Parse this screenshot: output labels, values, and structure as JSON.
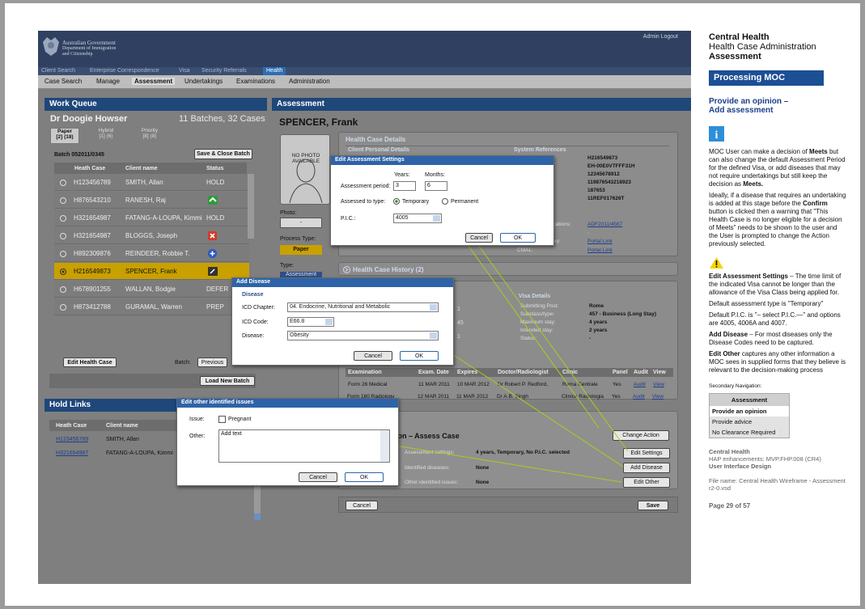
{
  "app": {
    "agency_line1": "Australian Government",
    "agency_line2": "Department of Immigration",
    "agency_line3": "and Citizenship",
    "top_links": "Admin  Logout"
  },
  "nav1": [
    "Client Search",
    "Enterprise Correspondence",
    "Visa",
    "Security Referrals",
    "Health"
  ],
  "nav2": [
    "Case Search",
    "Manage",
    "Assessment",
    "Undertakings",
    "Examinations",
    "Administration"
  ],
  "work_queue": {
    "title": "Work Queue",
    "user": "Dr Doogie Howser",
    "summary": "11 Batches, 32 Cases",
    "tabs": [
      {
        "l1": "Paper",
        "l2": "[2] (18)"
      },
      {
        "l1": "Hybrid",
        "l2": "[1] (6)"
      },
      {
        "l1": "Priority",
        "l2": "[8] (8)"
      }
    ],
    "batch": "Batch 052011/0345",
    "save_close": "Save & Close Batch",
    "columns": [
      "Heath Case",
      "Client name",
      "Status"
    ],
    "rows": [
      {
        "case": "H123456789",
        "name": "SMITH, Allan",
        "status": "HOLD"
      },
      {
        "case": "H876543210",
        "name": "RANESH, Raj",
        "status": ""
      },
      {
        "case": "H321654987",
        "name": "FATANG-A-LOUPA, Kimmi",
        "status": "HOLD"
      },
      {
        "case": "H321654987",
        "name": "BLOGGS, Joseph",
        "status": ""
      },
      {
        "case": "H892309876",
        "name": "REINDEER, Robbie T.",
        "status": ""
      },
      {
        "case": "H216549873",
        "name": "SPENCER, Frank",
        "status": ""
      },
      {
        "case": "H678901255",
        "name": "WALLAN, Bodgie",
        "status": "DEFER"
      },
      {
        "case": "H873412788",
        "name": "GURAMAL, Warren",
        "status": "PREP"
      }
    ],
    "edit_case": "Edit Health Case",
    "batch_label": "Batch:",
    "previous": "Previous",
    "load_new": "Load New Batch"
  },
  "hold_links": {
    "title": "Hold Links",
    "columns": [
      "Heath Case",
      "Client name"
    ],
    "rows": [
      {
        "case": "H123456789",
        "name": "SMITH, Allan"
      },
      {
        "case": "H321654987",
        "name": "FATANG-A-LOUPA, Kimmi"
      }
    ]
  },
  "assessment": {
    "title": "Assessment",
    "client": "SPENCER, Frank",
    "photo": "NO PHOTO AVAILABLE",
    "photo_label": "Photo:",
    "photo_val": "-",
    "process_type_label": "Process Type:",
    "process_type": "Paper",
    "type_label": "Type:",
    "type_val": "Assessment",
    "health_case_details": "Health Case Details",
    "client_personal": "Client Personal Details",
    "system_refs": "System References",
    "refs": [
      "H216549873",
      "EH-00E0VTFFF31H",
      "12345678912",
      "119876543218923",
      "187653",
      "11REF017626T"
    ],
    "app_label": "ications:",
    "app_link": "ADF2011/4567",
    "dash": "-",
    "ory_label": "ory:",
    "portal1": "Portal Link",
    "cmal_label": "CMAL:",
    "portal2": "Portal Link",
    "history": "Health Case History (2)",
    "visa_details": "Visa Details",
    "visa": [
      {
        "k": "Submitting Post:",
        "v": "Rome"
      },
      {
        "k": "Subclass/type:",
        "v": "457 - Business (Long Stay)"
      },
      {
        "k": "Maximum stay:",
        "v": "4 years"
      },
      {
        "k": "Intended stay:",
        "v": "2 years"
      },
      {
        "k": "Status:",
        "v": "-"
      }
    ],
    "left_partial": [
      "1",
      "45",
      "1"
    ],
    "exam_columns": [
      "Examination",
      "Exam. Date",
      "Expires",
      "Doctor/Radiologist",
      "Clinic",
      "Panel",
      "Audit",
      "View"
    ],
    "exams": [
      {
        "exam": "Form 26 Medical",
        "date": "11 MAR 2011",
        "exp": "10 MAR 2012",
        "doc": "Dr Robert P. Redford,",
        "clinic": "Roma Centrale",
        "panel": "Yes",
        "audit": "Audit",
        "view": "View"
      },
      {
        "exam": "Form 160 Radiology",
        "date": "12 MAR 2011",
        "exp": "11 MAR 2012",
        "doc": "Dr A.B. Singh",
        "clinic": "Clinica Radiologia",
        "panel": "Yes",
        "audit": "Audit",
        "view": "View"
      }
    ],
    "assess_case_title": "ion – Assess Case",
    "change_action": "Change Action",
    "settings_label": "Assessment settings:",
    "settings_val": "4 years, Temporary, No P.I.C. selected",
    "edit_settings": "Edit Settings",
    "diseases_label": "Identified diseases:",
    "diseases_val": "None",
    "add_disease": "Add Disease",
    "other_label": "Other identified issues:",
    "other_val": "None",
    "edit_other": "Edit Other",
    "cancel": "Cancel",
    "save": "Save"
  },
  "dlg_settings": {
    "title": "Edit Assessment Settings",
    "years": "Years:",
    "months": "Months:",
    "period_label": "Assessment period:",
    "years_val": "3",
    "months_val": "6",
    "type_label": "Assessed to type:",
    "temporary": "Temporary",
    "permanent": "Permanent",
    "pic_label": "P.I.C.:",
    "pic_val": "4005",
    "cancel": "Cancel",
    "ok": "OK"
  },
  "dlg_disease": {
    "title": "Add Disease",
    "section": "Disease",
    "chapter_label": "ICD Chapter:",
    "chapter_val": "04. Endocrine, Nutritional and Metabolic",
    "code_label": "ICD Code:",
    "code_val": "E66.8",
    "disease_label": "Disease:",
    "disease_val": "Obesity",
    "cancel": "Cancel",
    "ok": "OK"
  },
  "dlg_other": {
    "title": "Edit other identified issues",
    "issue_label": "Issue:",
    "pregnant": "Pregnant",
    "other_label": "Other:",
    "placeholder": "Add text",
    "cancel": "Cancel",
    "ok": "OK"
  },
  "right": {
    "title1": "Central Health",
    "title2": "Health Case Administration",
    "title3": "Assessment",
    "banner": "Processing MOC",
    "subhead1": "Provide an opinion –",
    "subhead2": "Add assessment",
    "p1a": "MOC User can make a decision of ",
    "p1b": "Meets",
    "p1c": " but can also change the default Assessment Period for the defined Visa, or add diseases that may not require undertakings but still keep the decision as ",
    "p1d": "Meets.",
    "p2a": "Ideally, if a disease that requires an undertaking is added at this stage before the ",
    "p2b": "Confirm",
    "p2c": " button is clicked then a warning that \"This Health Case is no longer eligible for a decision of Meets\" needs to be shown to the user and the User is prompted to change the Action previously selected.",
    "p3a": "Edit Assessment Settings",
    "p3b": " – The time limit of the indicated Visa cannot be longer than the allowance of the Visa Class being applied for.",
    "p4": "Default assessment type is \"Temporary\"",
    "p5": "Default P.I.C. is \"– select P.I.C.—\" and options are 4005, 4006A and 4007.",
    "p6a": "Add Disease",
    "p6b": " – For most diseases only the Disease Codes need to be captured.",
    "p7a": "Edit Other",
    "p7b": " captures any other information a MOC sees in supplied forms that they believe is relevant to the decision-making process",
    "sec_nav": "Secondary Navigation:",
    "nav_head": "Assessment",
    "nav_items": [
      "Provide an opinion",
      "Provide advice",
      "No Clearance Required"
    ],
    "foot1": "Central Health",
    "foot2": "HAP enhancements: MVP.FHP.008 (CR4)",
    "foot3": "User Interface Design",
    "foot4": "File name: Central Health Wireframe - Assessment r2-0.vsd",
    "page": "Page 29 of 57"
  },
  "colors": {
    "header_blue": "#1e477a",
    "dialog_blue": "#2e63a8",
    "selected_row": "#c8a000",
    "banner": "#1c4f94",
    "arrow": "#a3d11a"
  }
}
